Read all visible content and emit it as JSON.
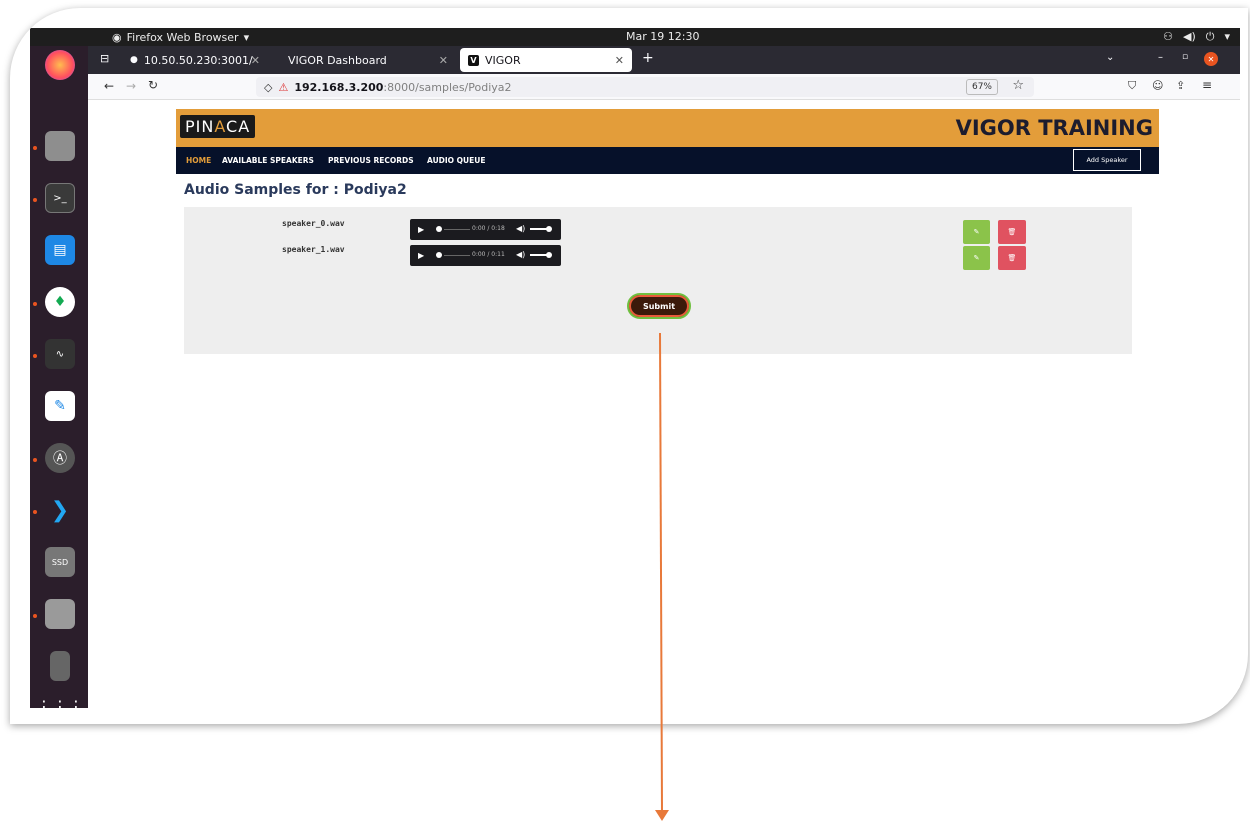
{
  "os": {
    "app_menu": "Firefox Web Browser",
    "clock": "Mar 19  12:30"
  },
  "browser": {
    "tabs": [
      {
        "label": "10.50.50.230:3001/"
      },
      {
        "label": "VIGOR Dashboard"
      },
      {
        "label": "VIGOR",
        "active": true
      }
    ],
    "url_host": "192.168.3.200",
    "url_rest": ":8000/samples/Podiya2",
    "zoom": "67%"
  },
  "site": {
    "logo": {
      "left": "PIN",
      "accent": "A",
      "right": "CA"
    },
    "brand": "VIGOR TRAINING",
    "nav": [
      "HOME",
      "AVAILABLE SPEAKERS",
      "PREVIOUS RECORDS",
      "AUDIO QUEUE"
    ],
    "add_speaker": "Add Speaker"
  },
  "main": {
    "title": "Audio Samples for : Podiya2",
    "samples": [
      {
        "file": "speaker_0.wav",
        "time": "0:00 / 0:18"
      },
      {
        "file": "speaker_1.wav",
        "time": "0:00 / 0:11"
      }
    ],
    "submit_label": "Submit"
  },
  "colors": {
    "header": "#e39d3a",
    "nav": "#06112a",
    "edit": "#8bc34a",
    "delete": "#e05260",
    "arrow": "#e8793a"
  }
}
